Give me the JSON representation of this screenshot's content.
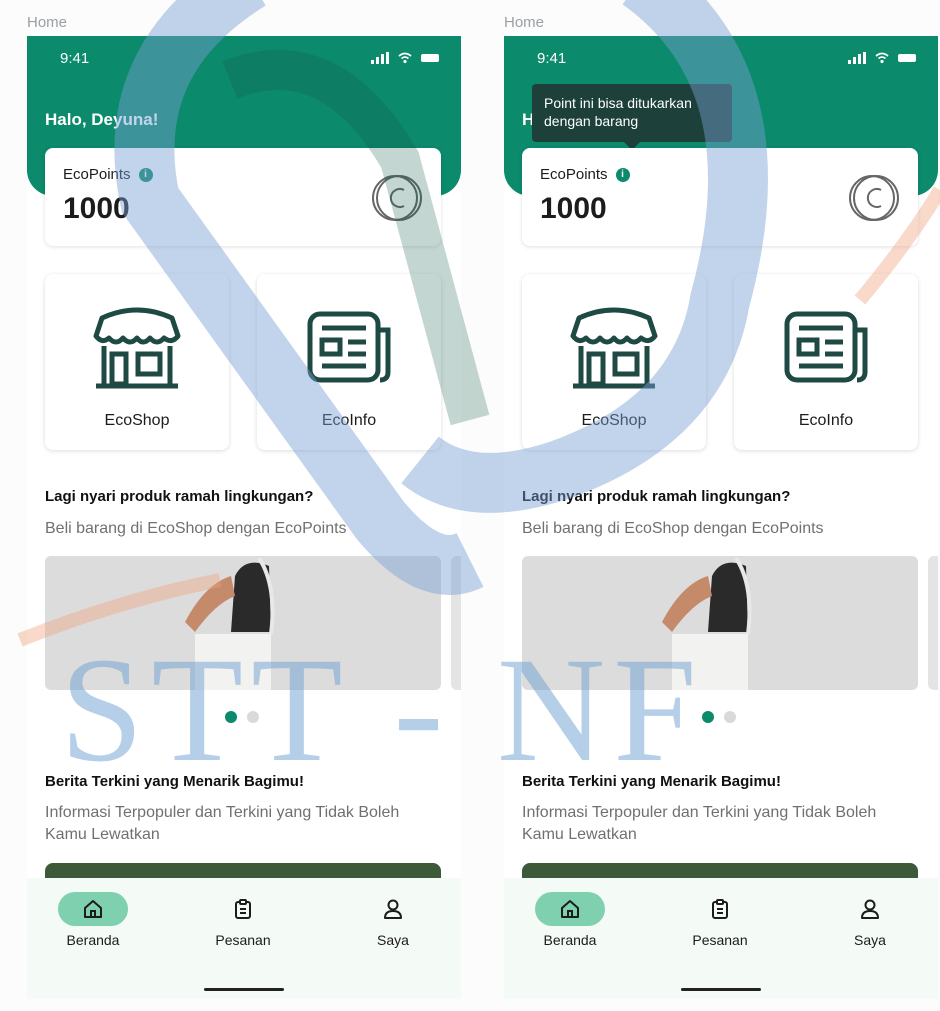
{
  "frame_label": "Home",
  "status_bar": {
    "time": "9:41"
  },
  "greeting": "Halo, Deyuna!",
  "points": {
    "label": "EcoPoints",
    "value": "1000"
  },
  "tooltip": {
    "text": "Point ini bisa ditukarkan dengan barang"
  },
  "tiles": [
    {
      "label": "EcoShop",
      "icon": "shop-icon"
    },
    {
      "label": "EcoInfo",
      "icon": "news-icon"
    }
  ],
  "promo": {
    "title": "Lagi nyari produk ramah lingkungan?",
    "subtitle": "Beli barang di EcoShop dengan EcoPoints"
  },
  "carousel": {
    "pages": 2,
    "active": 1
  },
  "news": {
    "title": "Berita Terkini yang Menarik Bagimu!",
    "subtitle": "Informasi Terpopuler dan Terkini yang Tidak Boleh Kamu Lewatkan"
  },
  "nav": [
    {
      "label": "Beranda",
      "icon": "home-icon",
      "active": true
    },
    {
      "label": "Pesanan",
      "icon": "clipboard-icon",
      "active": false
    },
    {
      "label": "Saya",
      "icon": "user-icon",
      "active": false
    }
  ],
  "watermark": {
    "text": "STT - NF"
  },
  "colors": {
    "primary": "#0b8a6c",
    "tooltip": "#1d403a",
    "nav_active": "#7fd0ae"
  }
}
